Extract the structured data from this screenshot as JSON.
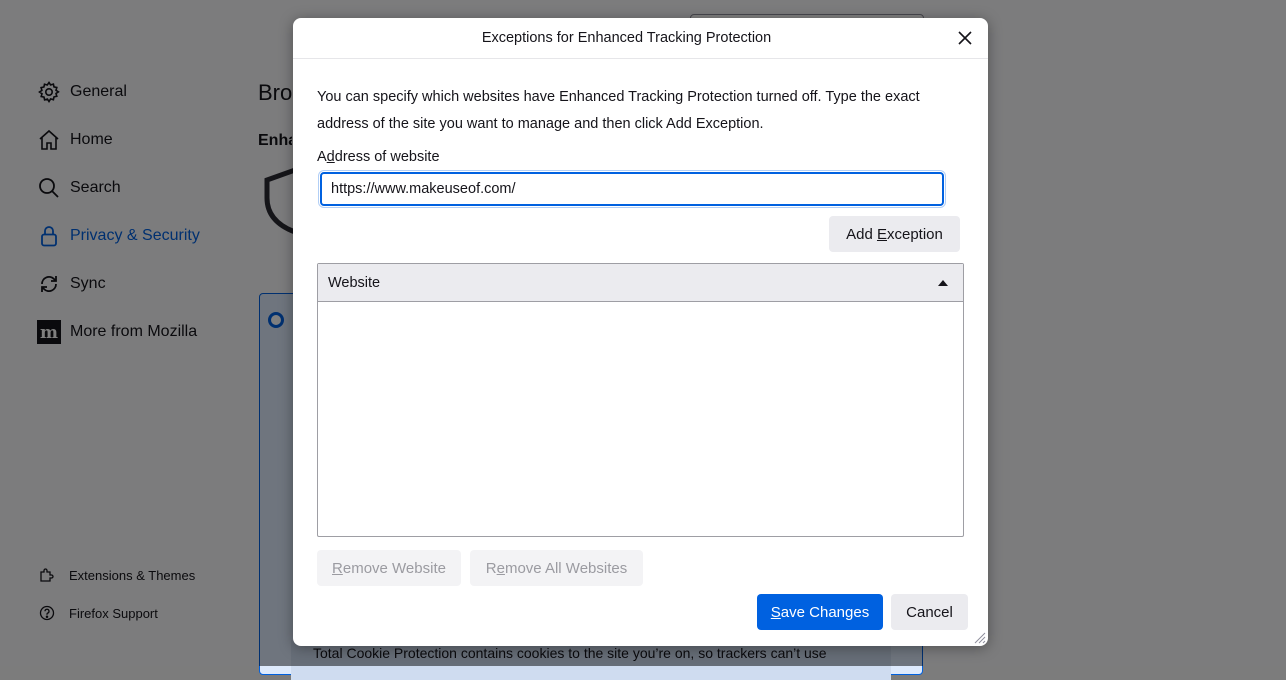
{
  "background": {
    "nav": [
      {
        "label": "General",
        "icon": "gear-icon"
      },
      {
        "label": "Home",
        "icon": "home-icon"
      },
      {
        "label": "Search",
        "icon": "search-icon"
      },
      {
        "label": "Privacy & Security",
        "icon": "lock-icon",
        "selected": true
      },
      {
        "label": "Sync",
        "icon": "sync-icon"
      },
      {
        "label": "More from Mozilla",
        "icon": "mozilla-icon"
      }
    ],
    "footer_nav": [
      {
        "label": "Extensions & Themes",
        "icon": "puzzle-icon"
      },
      {
        "label": "Firefox Support",
        "icon": "help-icon"
      }
    ],
    "heading_partial": "Brow",
    "subheading_partial": "Enha",
    "card_text": "Total Cookie Protection contains cookies to the site you’re on, so trackers can’t use"
  },
  "dialog": {
    "title": "Exceptions for Enhanced Tracking Protection",
    "intro": "You can specify which websites have Enhanced Tracking Protection turned off. Type the exact address of the site you want to manage and then click Add Exception.",
    "address_label_pre": "A",
    "address_label_accesskey": "d",
    "address_label_post": "dress of website",
    "address_value": "https://www.makeuseof.com/",
    "add_exception": {
      "pre": "Add ",
      "key": "E",
      "post": "xception"
    },
    "column_header": "Website",
    "remove_website": {
      "pre": "",
      "key": "R",
      "post": "emove Website"
    },
    "remove_all": {
      "pre": "R",
      "key": "e",
      "post": "move All Websites"
    },
    "save_changes": {
      "pre": "",
      "key": "S",
      "post": "ave Changes"
    },
    "cancel": "Cancel"
  },
  "colors": {
    "accent": "#0061e0",
    "overlay": "#7c7c7c",
    "button_gray": "#ebebef"
  }
}
